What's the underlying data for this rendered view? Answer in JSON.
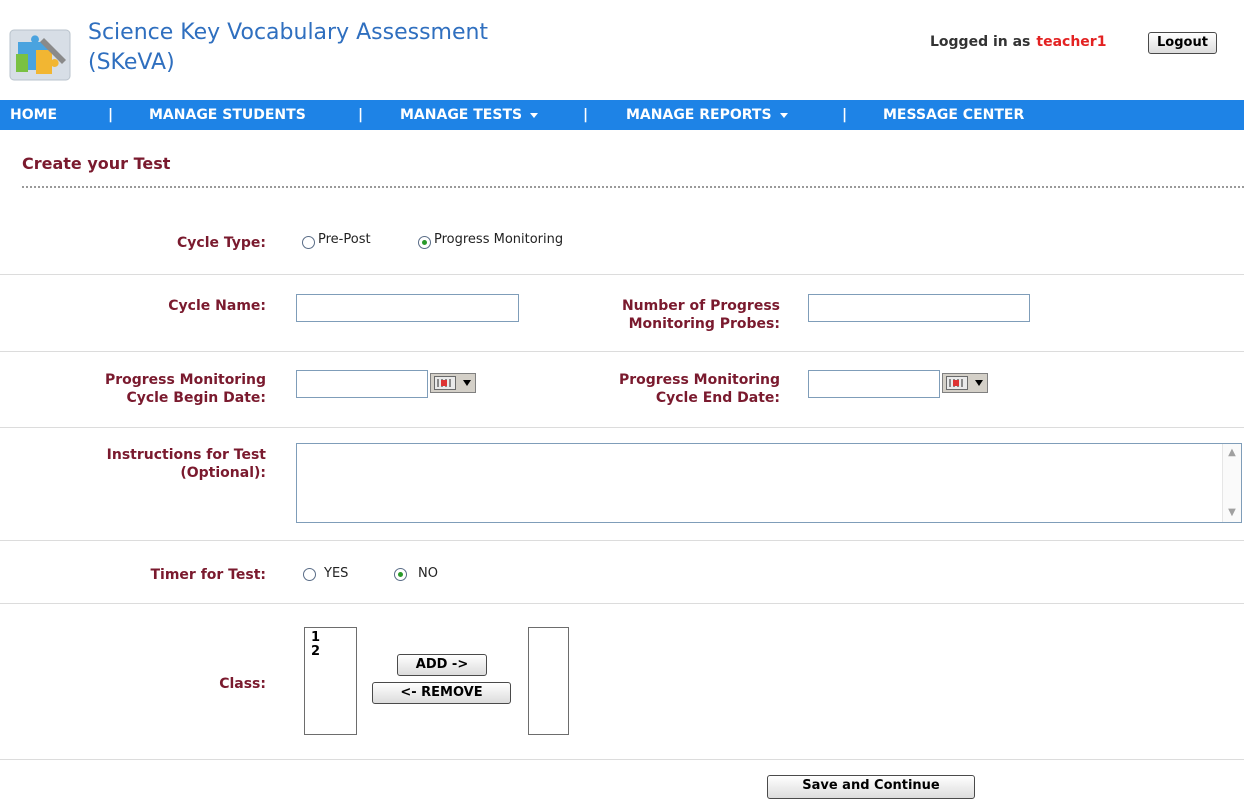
{
  "app": {
    "title_line1": "Science Key Vocabulary Assessment",
    "title_line2": "(SKeVA)",
    "logged_in_prefix": "Logged in as",
    "user": "teacher1",
    "logout_label": "Logout"
  },
  "nav": {
    "items": [
      "HOME",
      "MANAGE STUDENTS",
      "MANAGE TESTS",
      "MANAGE REPORTS",
      "MESSAGE CENTER"
    ],
    "separator": "|"
  },
  "page": {
    "heading": "Create your Test"
  },
  "form": {
    "cycle_type": {
      "label": "Cycle Type:",
      "options": [
        "Pre-Post",
        "Progress Monitoring"
      ],
      "selected": "Progress Monitoring"
    },
    "cycle_name": {
      "label": "Cycle Name:",
      "value": ""
    },
    "probes": {
      "label_line1": "Number of Progress",
      "label_line2": "Monitoring Probes:",
      "value": ""
    },
    "begin_date": {
      "label_line1": "Progress Monitoring",
      "label_line2": "Cycle Begin Date:",
      "value": ""
    },
    "end_date": {
      "label_line1": "Progress Monitoring",
      "label_line2": "Cycle End Date:",
      "value": ""
    },
    "instructions": {
      "label_line1": "Instructions for Test",
      "label_line2": "(Optional):",
      "value": ""
    },
    "timer": {
      "label": "Timer for Test:",
      "options": [
        "YES",
        "NO"
      ],
      "selected": "NO"
    },
    "class": {
      "label": "Class:",
      "available": [
        "1",
        "2"
      ],
      "selected": [],
      "add_label": "ADD ->",
      "remove_label": "<- REMOVE"
    },
    "save_label": "Save and Continue"
  },
  "colors": {
    "nav_bg": "#1e83e6",
    "label": "#7a1a2e",
    "title": "#2f6fbf",
    "username": "#e32222"
  }
}
